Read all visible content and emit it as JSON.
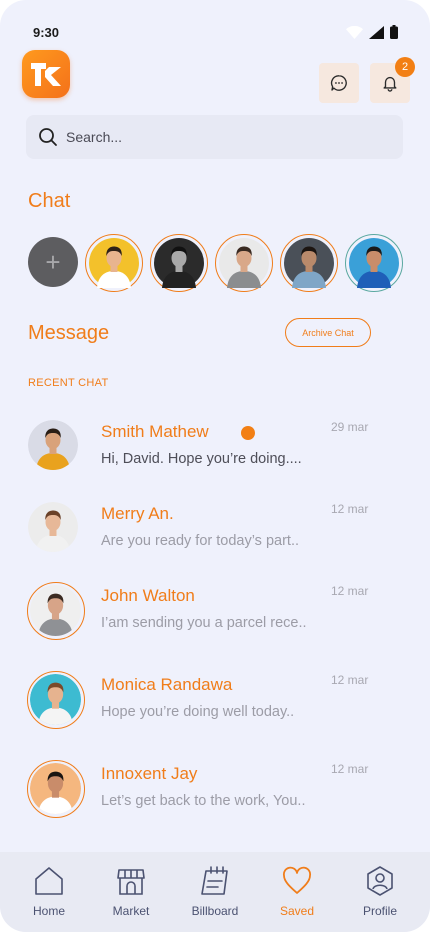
{
  "status_bar": {
    "time": "9:30"
  },
  "header": {
    "logo_text": "TK",
    "notification_count": "2",
    "accent": "#f07d1a"
  },
  "search": {
    "placeholder": "Search..."
  },
  "chat_section": {
    "title": "Chat",
    "add_symbol": "+",
    "stories": [
      {
        "name": "story-1",
        "bg": "#f3c12b",
        "skin": "#e8b48f",
        "shirt": "#ffffff",
        "hair": "#2e2118"
      },
      {
        "name": "story-2",
        "bg": "#2b2b2b",
        "skin": "#a9a9a9",
        "shirt": "#222222",
        "hair": "#111111"
      },
      {
        "name": "story-3",
        "bg": "#e9e9e9",
        "skin": "#d9a889",
        "shirt": "#8b8d8f",
        "hair": "#3a2a21"
      },
      {
        "name": "story-4",
        "bg": "#4a5058",
        "skin": "#b98a6b",
        "shirt": "#7fa6c7",
        "hair": "#1c1511"
      },
      {
        "name": "story-5",
        "bg": "#3aa0d8",
        "skin": "#c98d6a",
        "shirt": "#1f5fb8",
        "hair": "#1a1a1a"
      }
    ]
  },
  "message_section": {
    "title": "Message",
    "archive_label": "Archive Chat",
    "recent_label": "RECENT CHAT",
    "conversations": [
      {
        "name": "Smith Mathew",
        "preview": "Hi, David. Hope you’re doing....",
        "time": "29 mar",
        "unread": true,
        "bg": "#d9dbe6",
        "skin": "#d9a27a",
        "shirt": "#e9a21e",
        "hair": "#2a1e15"
      },
      {
        "name": "Merry An.",
        "preview": "Are you ready for today’s part..",
        "time": "12 mar",
        "unread": false,
        "bg": "#ececec",
        "skin": "#e7b898",
        "shirt": "#f1f1f1",
        "hair": "#6a4128"
      },
      {
        "name": "John Walton",
        "preview": "I’am sending you a parcel rece..",
        "time": "12 mar",
        "unread": false,
        "bg": "#efefef",
        "skin": "#d7a488",
        "shirt": "#8f9195",
        "hair": "#3b2b22"
      },
      {
        "name": "Monica Randawa",
        "preview": "Hope you’re doing well today..",
        "time": "12 mar",
        "unread": false,
        "bg": "#3dbbd1",
        "skin": "#e6b38f",
        "shirt": "#f4f4f4",
        "hair": "#7a4a2a"
      },
      {
        "name": "Innoxent Jay",
        "preview": "Let’s get back to the work, You..",
        "time": "12 mar",
        "unread": false,
        "bg": "#f5b77f",
        "skin": "#c98c6a",
        "shirt": "#ffffff",
        "hair": "#1a1512"
      }
    ]
  },
  "bottom_nav": {
    "items": [
      {
        "label": "Home",
        "icon": "home-icon",
        "active": false
      },
      {
        "label": "Market",
        "icon": "store-icon",
        "active": false
      },
      {
        "label": "Billboard",
        "icon": "billboard-icon",
        "active": false
      },
      {
        "label": "Saved",
        "icon": "heart-icon",
        "active": true
      },
      {
        "label": "Profile",
        "icon": "profile-icon",
        "active": false
      }
    ]
  }
}
